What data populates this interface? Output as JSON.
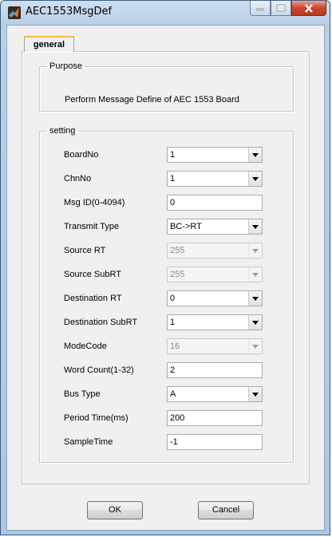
{
  "window": {
    "title": "AEC1553MsgDef"
  },
  "tab": {
    "label": "general"
  },
  "purpose": {
    "legend": "Purpose",
    "text": "Perform Message Define of AEC 1553 Board"
  },
  "setting": {
    "legend": "setting",
    "fields": [
      {
        "label": "BoardNo",
        "value": "1",
        "type": "select",
        "enabled": true
      },
      {
        "label": "ChnNo",
        "value": "1",
        "type": "select",
        "enabled": true
      },
      {
        "label": "Msg ID(0-4094)",
        "value": "0",
        "type": "text",
        "enabled": true
      },
      {
        "label": "Transmit Type",
        "value": "BC->RT",
        "type": "select",
        "enabled": true
      },
      {
        "label": "Source RT",
        "value": "255",
        "type": "select",
        "enabled": false
      },
      {
        "label": "Source SubRT",
        "value": "255",
        "type": "select",
        "enabled": false
      },
      {
        "label": "Destination RT",
        "value": "0",
        "type": "select",
        "enabled": true
      },
      {
        "label": "Destination SubRT",
        "value": "1",
        "type": "select",
        "enabled": true
      },
      {
        "label": "ModeCode",
        "value": "16",
        "type": "select",
        "enabled": false
      },
      {
        "label": "Word Count(1-32)",
        "value": "2",
        "type": "text",
        "enabled": true
      },
      {
        "label": "Bus Type",
        "value": "A",
        "type": "select",
        "enabled": true
      },
      {
        "label": "Period Time(ms)",
        "value": "200",
        "type": "text",
        "enabled": true
      },
      {
        "label": "SampleTime",
        "value": "-1",
        "type": "text",
        "enabled": true
      }
    ]
  },
  "buttons": {
    "ok": "OK",
    "cancel": "Cancel"
  }
}
